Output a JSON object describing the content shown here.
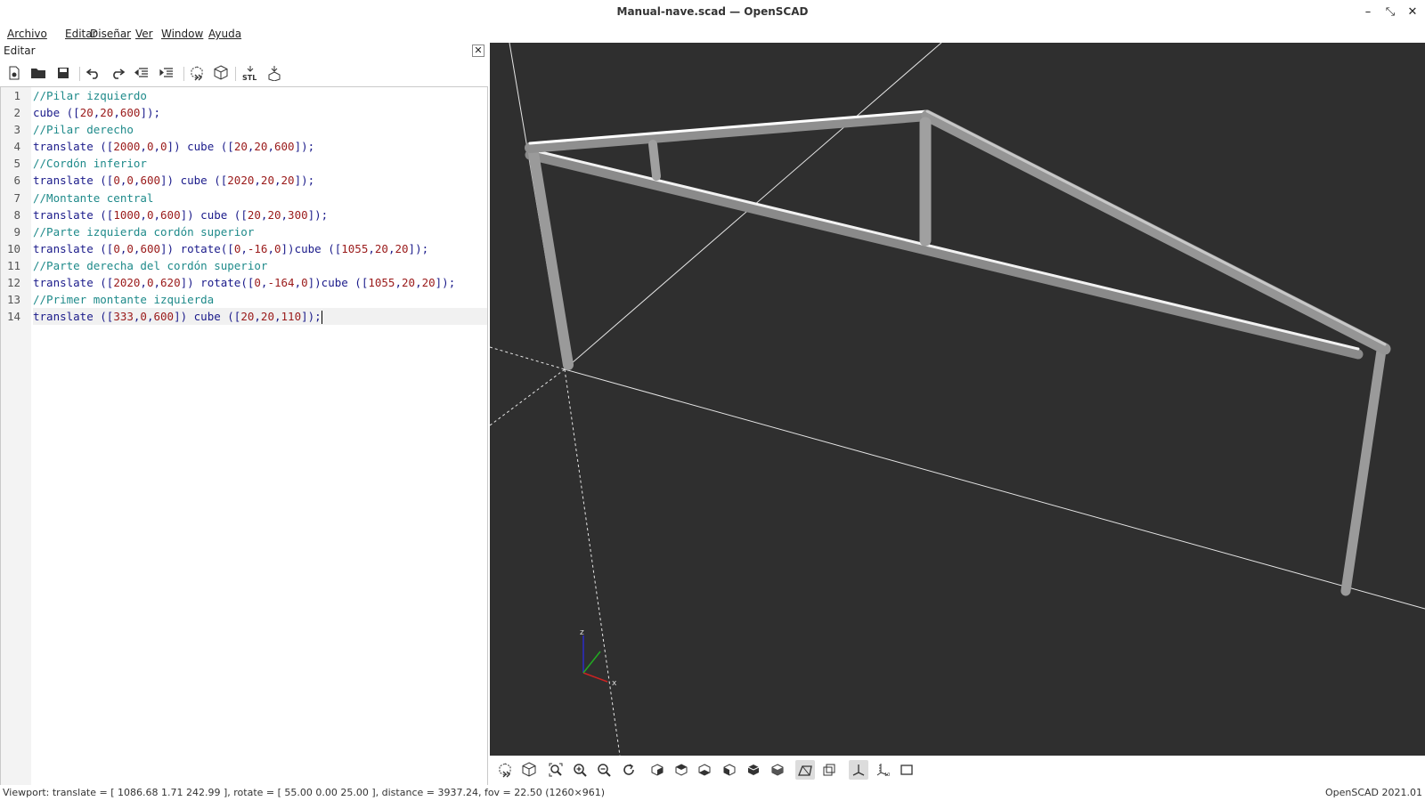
{
  "window": {
    "title": "Manual-nave.scad — OpenSCAD"
  },
  "menu": [
    "Archivo",
    "Editar",
    "Diseñar",
    "Ver",
    "Window",
    "Ayuda"
  ],
  "editor": {
    "header_label": "Editar",
    "line_numbers": [
      "1",
      "2",
      "3",
      "4",
      "5",
      "6",
      "7",
      "8",
      "9",
      "10",
      "11",
      "12",
      "13",
      "14"
    ],
    "lines": [
      "//Pilar izquierdo",
      "cube ([20,20,600]);",
      "//Pilar derecho",
      "translate ([2000,0,0]) cube ([20,20,600]);",
      "//Cordón inferior",
      "translate ([0,0,600]) cube ([2020,20,20]);",
      "//Montante central",
      "translate ([1000,0,600]) cube ([20,20,300]);",
      "//Parte izquierda cordón superior",
      "translate ([0,0,600]) rotate([0,-16,0])cube ([1055,20,20]);",
      "//Parte derecha del cordón superior",
      "translate ([2020,0,620]) rotate([0,-164,0])cube ([1055,20,20]);",
      "//Primer montante izquierda",
      "translate ([333,0,600]) cube ([20,20,110]);"
    ]
  },
  "toolbar_icons": [
    "new-file-icon",
    "open-file-icon",
    "save-icon",
    "undo-icon",
    "redo-icon",
    "unindent-icon",
    "indent-icon",
    "preview-icon",
    "render-icon",
    "export-stl-icon",
    "send-to-print-icon"
  ],
  "viewport": {
    "axes": {
      "x": "x",
      "z": "z"
    },
    "background": "#2f2f2f"
  },
  "view_toolbar_icons": [
    "preview-icon",
    "render-icon",
    "view-all-icon",
    "zoom-in-icon",
    "zoom-out-icon",
    "reset-view-icon",
    "view-right-icon",
    "view-top-icon",
    "view-bottom-icon",
    "view-left-icon",
    "view-front-icon",
    "view-back-icon",
    "perspective-icon",
    "orthogonal-icon",
    "show-axes-icon",
    "show-scale-icon",
    "show-edges-icon"
  ],
  "status": {
    "viewport_text": "Viewport: translate = [ 1086.68 1.71 242.99 ], rotate = [ 55.00 0.00 25.00 ], distance = 3937.24, fov = 22.50 (1260×961)",
    "version": "OpenSCAD 2021.01"
  }
}
